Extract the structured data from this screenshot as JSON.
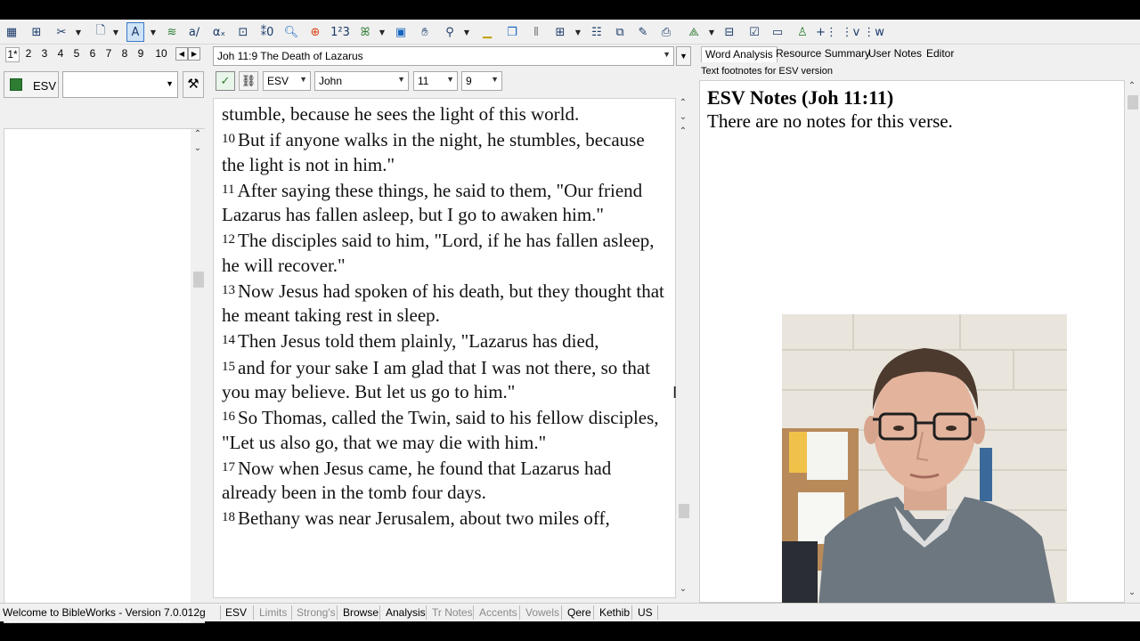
{
  "toolbar": {
    "icons": [
      "grid-icon",
      "tree-icon",
      "tools-icon",
      "new-doc-icon",
      "text-highlight-icon",
      "word-list-icon",
      "check-icon",
      "subscript-icon",
      "equation-icon",
      "count-icon",
      "search-icon",
      "target-icon",
      "numbers-icon",
      "person-icon",
      "save-icon",
      "hand-icon",
      "stamp-icon",
      "highlight-icon",
      "windows-icon",
      "columns-icon",
      "grid2-icon",
      "copy-icon",
      "edit-icon",
      "table-icon",
      "printer-icon",
      "highlighter-icon",
      "boxes-icon",
      "checklist-icon",
      "frame-icon",
      "person2-icon",
      "plus-icon",
      "verse-e-icon",
      "verse-w-icon"
    ]
  },
  "left": {
    "tabs": [
      "1*",
      "2",
      "3",
      "4",
      "5",
      "6",
      "7",
      "8",
      "9",
      "10"
    ],
    "version_label": "ESV",
    "search_value": ""
  },
  "center": {
    "reference": "Joh 11:9 The Death of Lazarus",
    "version": "ESV",
    "book": "John",
    "chapter": "11",
    "verse": "9",
    "passage": [
      {
        "n": "",
        "text": "stumble, because he sees the light of this world."
      },
      {
        "n": "10",
        "text": "But if anyone walks in the night, he stumbles, because the light is not in him.\""
      },
      {
        "n": "11",
        "text": "After saying these things, he said to them, \"Our friend Lazarus has fallen asleep, but I go to awaken him.\""
      },
      {
        "n": "12",
        "text": "The disciples said to him, \"Lord, if he has fallen asleep, he will recover.\""
      },
      {
        "n": "13",
        "text": "Now Jesus had spoken of his death, but they thought that he meant taking rest in sleep."
      },
      {
        "n": "14",
        "text": "Then Jesus told them plainly, \"Lazarus has died,"
      },
      {
        "n": "15",
        "text": "and for your sake I am glad that I was not there, so that you may believe. But let us go to him.\""
      },
      {
        "n": "16",
        "text": "So Thomas, called the Twin, said to his fellow disciples, \"Let us also go, that we may die with him.\""
      },
      {
        "n": "17",
        "text": "Now when Jesus came, he found that Lazarus had already been in the tomb four days."
      },
      {
        "n": "18",
        "text": "Bethany was near Jerusalem, about two miles off,"
      }
    ]
  },
  "right": {
    "tabs": [
      "Word Analysis",
      "Resource Summary",
      "User Notes",
      "Editor"
    ],
    "active_tab": "Word Analysis",
    "subtitle": "Text footnotes for ESV version",
    "notes_title": "ESV Notes (Joh 11:11)",
    "notes_body": "There are no notes for this verse."
  },
  "status": {
    "welcome": "Welcome to BibleWorks - Version 7.0.012g",
    "items": [
      {
        "label": "ESV",
        "enabled": true
      },
      {
        "label": "Limits",
        "enabled": false
      },
      {
        "label": "Strong's",
        "enabled": false
      },
      {
        "label": "Browse",
        "enabled": true
      },
      {
        "label": "Analysis",
        "enabled": true
      },
      {
        "label": "Tr Notes",
        "enabled": false
      },
      {
        "label": "Accents",
        "enabled": false
      },
      {
        "label": "Vowels",
        "enabled": false
      },
      {
        "label": "Qere",
        "enabled": true
      },
      {
        "label": "Kethib",
        "enabled": true
      },
      {
        "label": "US",
        "enabled": true
      }
    ]
  },
  "colors": {
    "accent": "#2e7d32",
    "disabled_text": "#8a8a8a"
  }
}
